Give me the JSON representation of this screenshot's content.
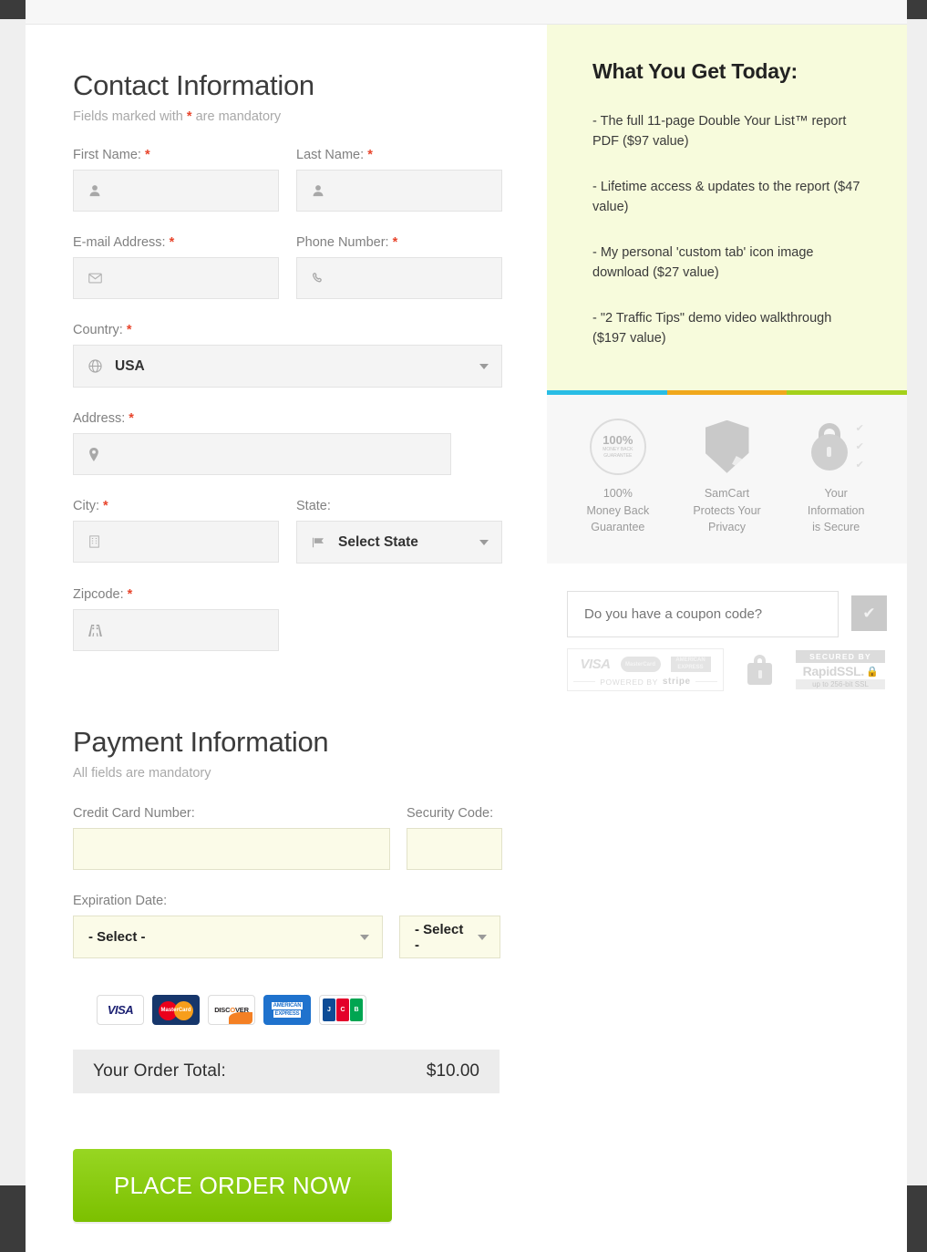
{
  "contact": {
    "title": "Contact Information",
    "subtitle_before": "Fields marked with ",
    "subtitle_star": "*",
    "subtitle_after": " are mandatory",
    "fields": {
      "first_name_label": "First Name:",
      "last_name_label": "Last Name:",
      "email_label": "E-mail Address:",
      "phone_label": "Phone Number:",
      "country_label": "Country:",
      "country_value": "USA",
      "address_label": "Address:",
      "city_label": "City:",
      "state_label": "State:",
      "state_value": "Select State",
      "zipcode_label": "Zipcode:"
    },
    "icons": {
      "first_name": "user-icon",
      "last_name": "user-icon",
      "email": "envelope-icon",
      "phone": "phone-icon",
      "country": "globe-icon",
      "address": "map-pin-icon",
      "city": "building-icon",
      "state": "flag-icon",
      "zipcode": "road-icon"
    }
  },
  "payment": {
    "title": "Payment Information",
    "subtitle": "All fields are mandatory",
    "credit_card_label": "Credit Card Number:",
    "security_code_label": "Security Code:",
    "expiration_label": "Expiration Date:",
    "exp_month_value": "- Select -",
    "exp_year_value": "- Select -",
    "accepted_cards": [
      "VISA",
      "MasterCard",
      "DISCOVER",
      "AMERICAN EXPRESS",
      "JCB"
    ],
    "total_label": "Your Order Total:",
    "total_value": "$10.00",
    "order_button": "PLACE ORDER NOW",
    "button_color": "#8ccc16"
  },
  "promo": {
    "heading": "What You Get Today:",
    "items": [
      "- The full 11-page Double Your List™ report PDF ($97 value)",
      "- Lifetime access & updates to the report ($47 value)",
      "- My personal 'custom tab' icon image download ($27 value)",
      "- \"2 Traffic Tips\" demo video walkthrough ($197 value)"
    ],
    "background": "#f7fbdc",
    "stripe_colors": [
      "#29bde5",
      "#f0a81c",
      "#a4d11b"
    ]
  },
  "trust_badges": [
    {
      "icon": "money-back-seal-icon",
      "seal_pct": "100%",
      "seal_sub": "MONEY BACK",
      "seal_sub2": "GUARANTEE",
      "caption": "100%\nMoney Back\nGuarantee"
    },
    {
      "icon": "shield-icon",
      "caption": "SamCart\nProtects Your\nPrivacy"
    },
    {
      "icon": "padlock-icon",
      "caption": "Your\nInformation\nis Secure"
    }
  ],
  "coupon": {
    "placeholder": "Do you have a coupon code?",
    "value": "",
    "submit_icon": "checkmark-icon"
  },
  "security_seals": {
    "stripe_cards": [
      "VISA",
      "MasterCard",
      "AMERICAN EXPRESS"
    ],
    "stripe_powered_by": "POWERED BY",
    "stripe_brand": "stripe",
    "padlock_icon": "padlock-icon",
    "rapidssl_top": "SECURED BY",
    "rapidssl_brand": "RapidSSL.",
    "rapidssl_bottom": "up to 256-bit SSL"
  }
}
